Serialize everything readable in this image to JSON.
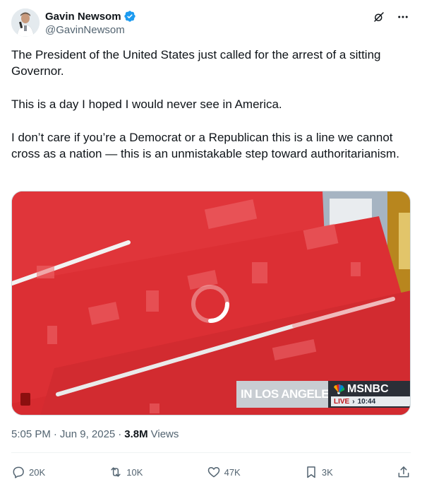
{
  "author": {
    "display_name": "Gavin Newsom",
    "handle": "@GavinNewsom",
    "verified": true,
    "verified_icon": "verified-badge-icon"
  },
  "header_actions": {
    "grok_icon": "grok-icon",
    "more_icon": "more-icon"
  },
  "tweet": {
    "paragraphs": [
      "The President of the United States just called for the arrest of a sitting Governor.",
      "This is a day I hoped I would never see in America.",
      "I don’t care if you’re a Democrat or a Republican this is a line we cannot cross as a nation — this is an unmistakable step toward authoritarianism."
    ]
  },
  "media": {
    "type": "video",
    "loading": true,
    "banner_text": "IN LOS ANGELES",
    "network": "MSNBC",
    "live_label": "LIVE",
    "live_time": "10:44"
  },
  "meta": {
    "time": "5:05 PM",
    "date": "Jun 9, 2025",
    "views_count": "3.8M",
    "views_label": "Views"
  },
  "actions": {
    "replies": "20K",
    "reposts": "10K",
    "likes": "47K",
    "bookmarks": "3K"
  },
  "colors": {
    "accent": "#1d9bf0",
    "text_primary": "#0f1419",
    "text_secondary": "#536471",
    "media_red": "#d42a2e"
  }
}
